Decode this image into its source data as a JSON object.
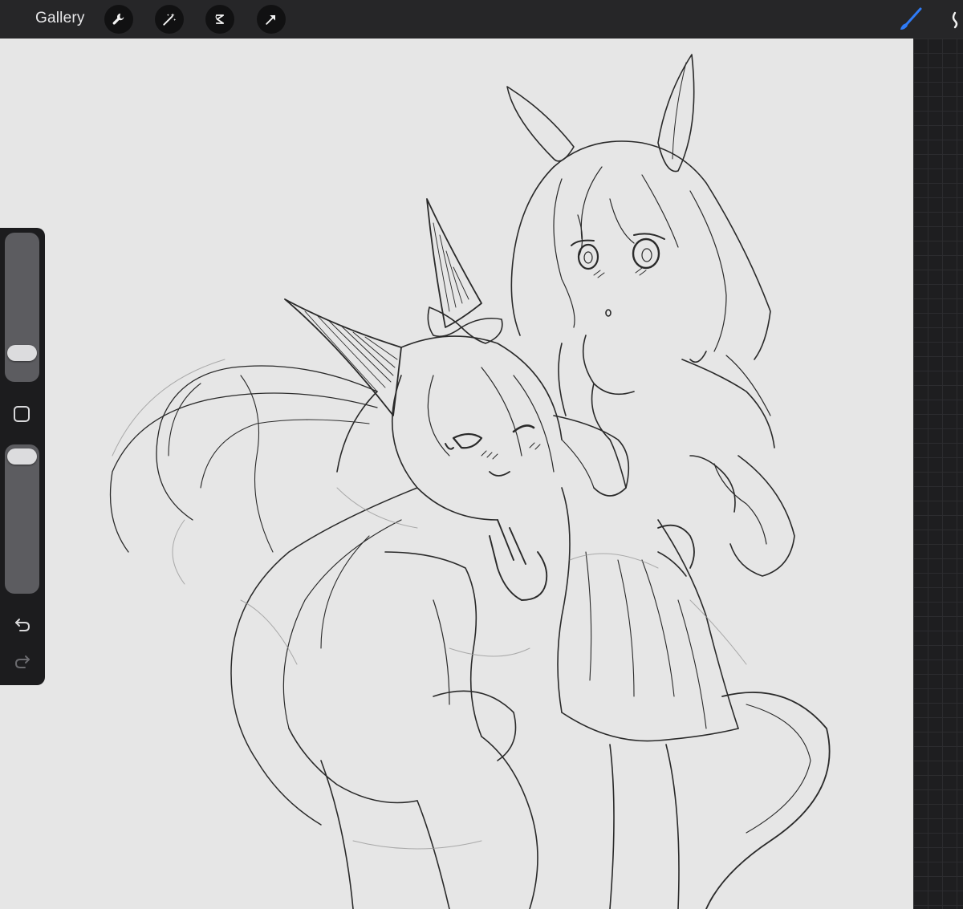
{
  "toolbar": {
    "gallery_label": "Gallery",
    "tools": [
      {
        "name": "actions",
        "icon": "wrench-icon"
      },
      {
        "name": "adjustments",
        "icon": "magic-wand-icon"
      },
      {
        "name": "selection",
        "icon": "selection-s-icon"
      },
      {
        "name": "transform",
        "icon": "arrow-cursor-icon"
      }
    ],
    "active_tool": {
      "name": "brush",
      "icon": "brush-icon"
    },
    "accent_color": "#2f7bf6"
  },
  "sidebar": {
    "brush_size": {
      "icon": "size-slider",
      "level": 0.22
    },
    "modify_icon": "square-modify-icon",
    "opacity": {
      "icon": "opacity-slider",
      "level": 0.98
    },
    "undo_icon": "undo-icon",
    "redo_icon": "redo-icon"
  },
  "canvas": {
    "background_color": "#e6e6e6",
    "content": "sketch-artwork"
  }
}
